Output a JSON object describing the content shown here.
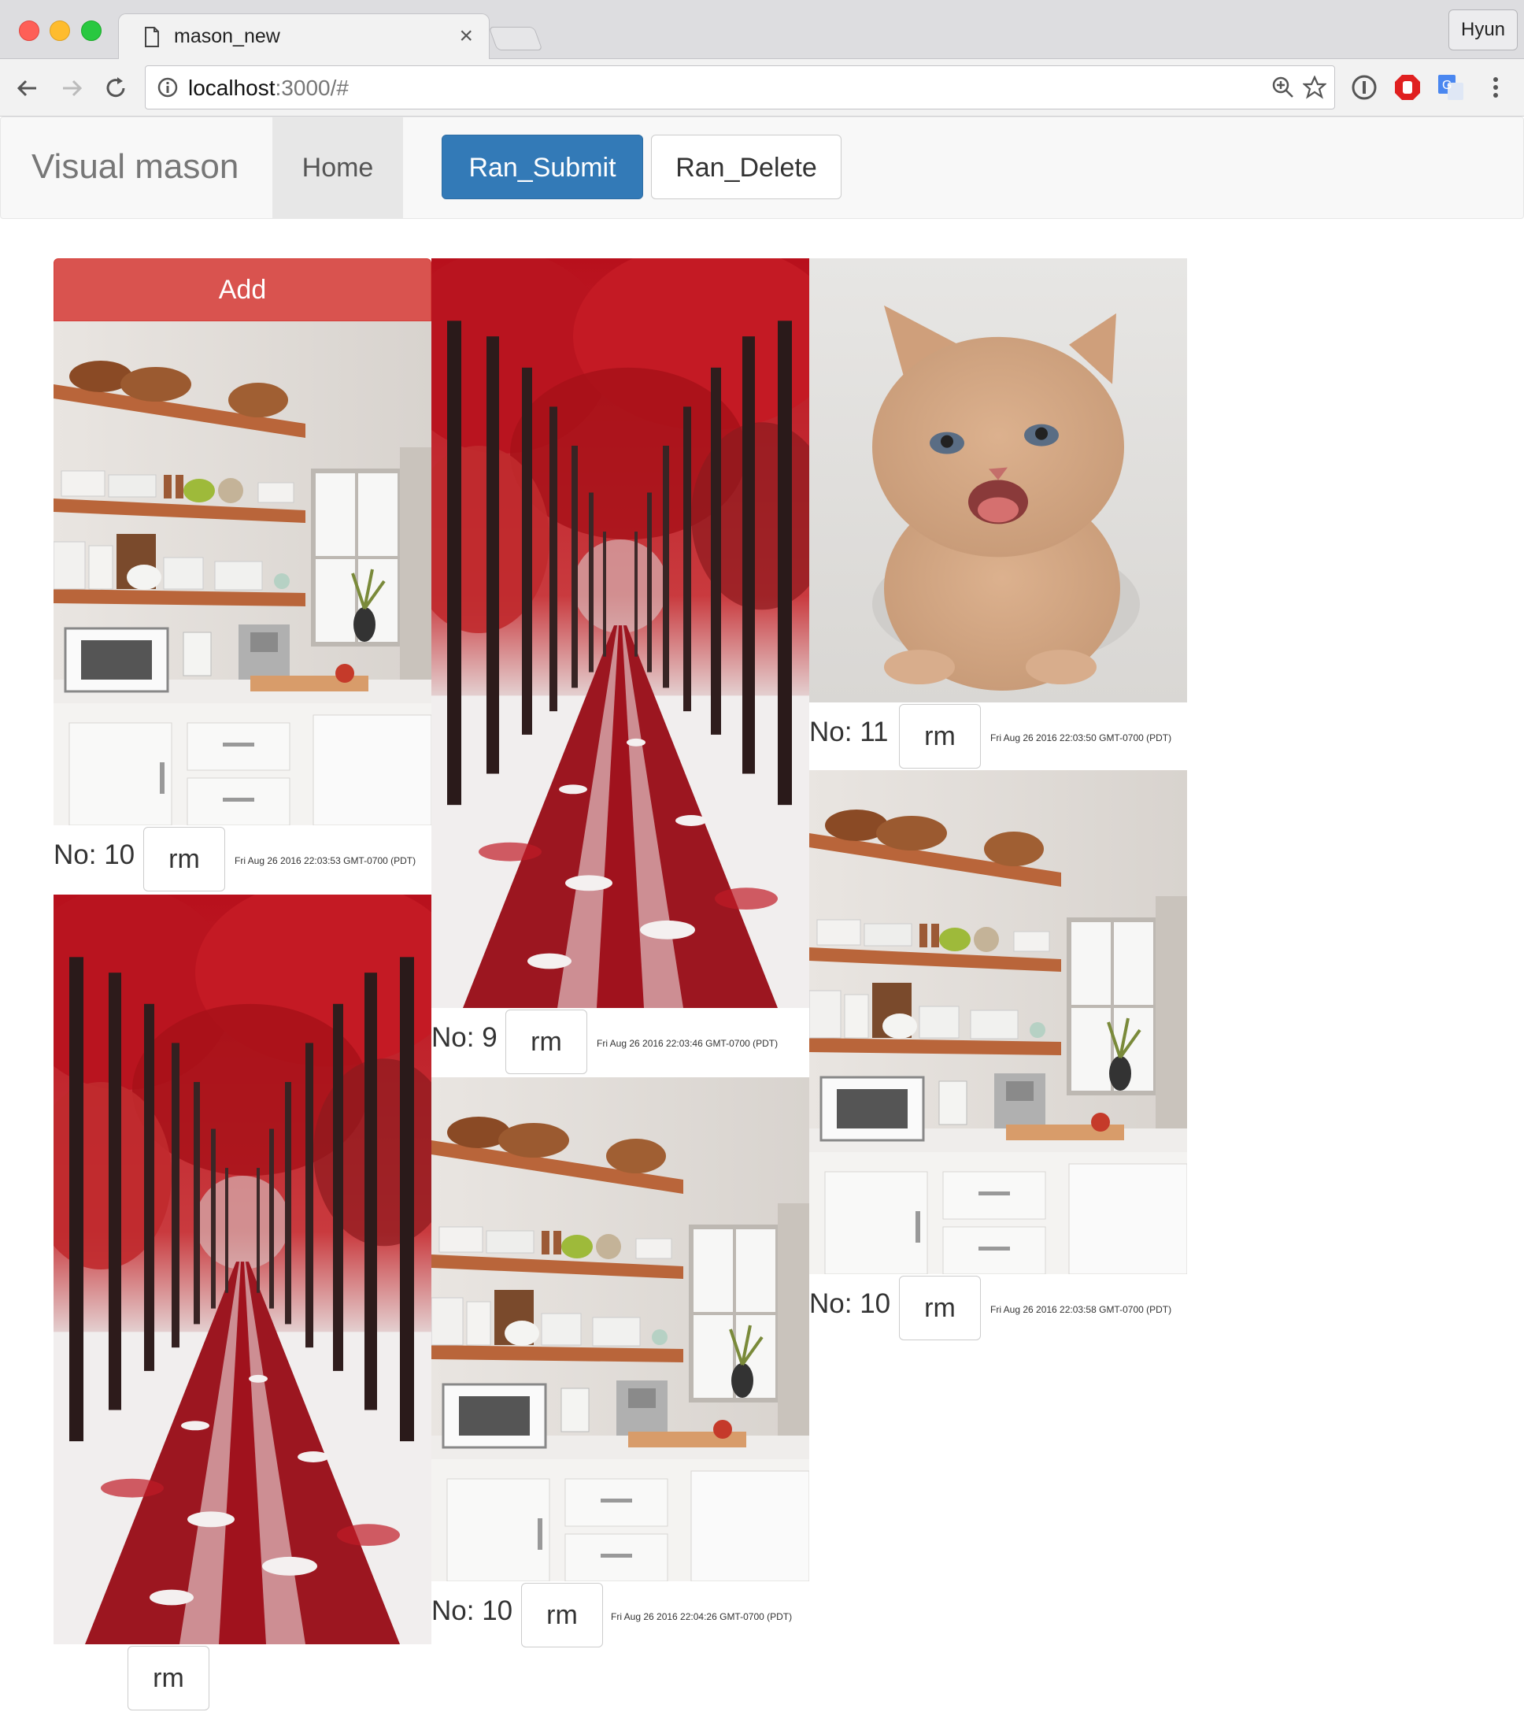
{
  "browser": {
    "tab_title": "mason_new",
    "tab_close": "×",
    "url_host": "localhost",
    "url_rest": ":3000/#",
    "profile_name": "Hyun"
  },
  "navbar": {
    "brand": "Visual mason",
    "home_label": "Home",
    "submit_label": "Ran_Submit",
    "delete_label": "Ran_Delete"
  },
  "masonry": {
    "add_label": "Add",
    "cards": [
      {
        "no": "No: 10",
        "rm": "rm",
        "timestamp": "Fri Aug 26 2016 22:03:53 GMT-0700 (PDT)",
        "image": "kitchen"
      },
      {
        "no": "No: 9",
        "rm": "rm",
        "timestamp": "Fri Aug 26 2016 22:03:46 GMT-0700 (PDT)",
        "image": "red-forest-road"
      },
      {
        "no": "No: 11",
        "rm": "rm",
        "timestamp": "Fri Aug 26 2016 22:03:50 GMT-0700 (PDT)",
        "image": "kitten"
      },
      {
        "no": "No: 10",
        "rm": "rm",
        "timestamp": "Fri Aug 26 2016 22:03:58 GMT-0700 (PDT)",
        "image": "kitchen"
      },
      {
        "no": "No: 10",
        "rm": "rm",
        "timestamp": "Fri Aug 26 2016 22:04:26 GMT-0700 (PDT)",
        "image": "kitchen"
      },
      {
        "no": "",
        "rm": "rm",
        "timestamp": "",
        "image": "red-forest-road"
      }
    ]
  },
  "colors": {
    "primary": "#337ab7",
    "danger": "#d9534f",
    "navbar_bg": "#f8f8f8"
  }
}
